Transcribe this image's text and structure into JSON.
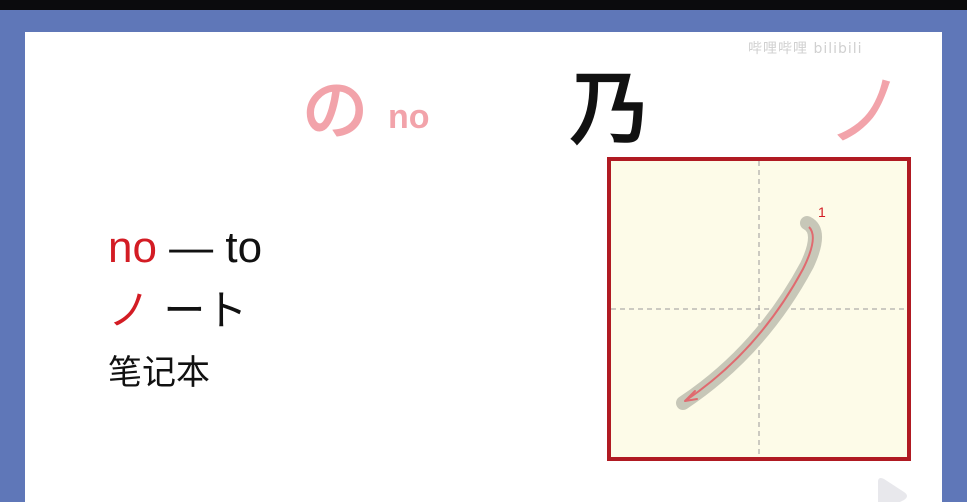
{
  "kana_card": {
    "hiragana": "の",
    "romaji": "no",
    "origin_kanji": "乃",
    "katakana": "ノ",
    "stroke_number": "1"
  },
  "vocab": {
    "romaji_red": "no",
    "romaji_rest": " — to",
    "kana_red": "ノ",
    "kana_rest": " ート",
    "meaning": "笔记本"
  },
  "watermark": {
    "text": "哔哩哔哩 bilibili"
  },
  "colors": {
    "frame_blue": "#5f77b8",
    "kana_pink": "#f2a3aa",
    "accent_red": "#d31c24",
    "grid_border": "#b01a22",
    "grid_fill": "#fdfbe8"
  }
}
